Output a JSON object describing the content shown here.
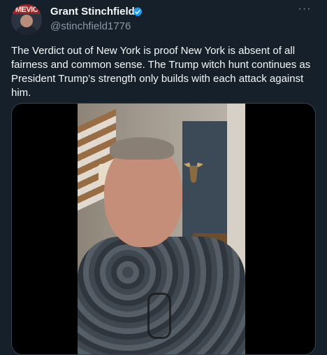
{
  "header": {
    "avatar_text": "MEVIC",
    "display_name": "Grant Stinchfield",
    "handle": "@stinchfield1776",
    "more": "···"
  },
  "tweet_text": "The Verdict out of New York is proof New York is absent of all fairness and common sense.  The Trump witch hunt continues as President Trump’s strength only builds with each attack against him.",
  "colors": {
    "background": "#15202b",
    "text": "#f7f9f9",
    "muted": "#8b98a5",
    "verified": "#1d9bf0"
  },
  "icons": {
    "verified": "verified-badge-icon",
    "more": "more-dots-icon"
  }
}
